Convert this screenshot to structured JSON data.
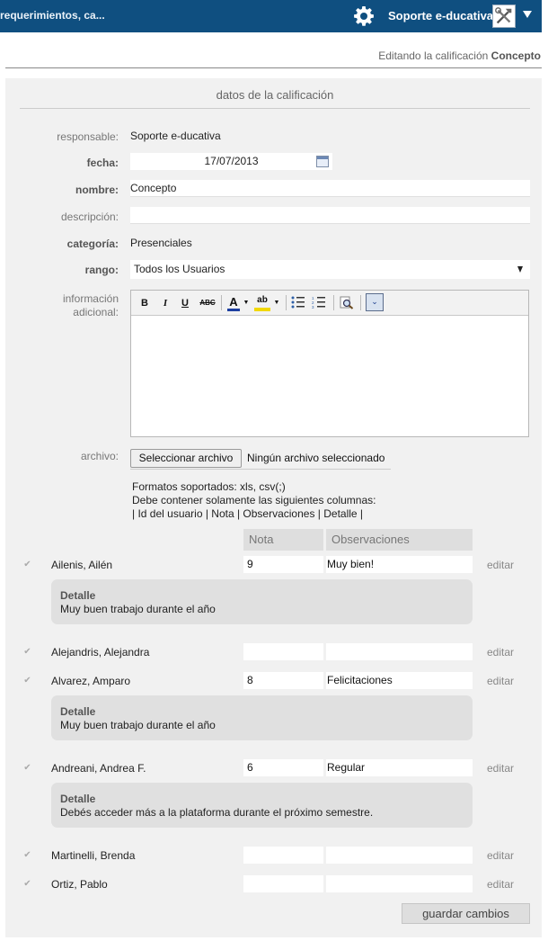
{
  "header": {
    "breadcrumb": "requerimientos, ca...",
    "user_name": "Soporte e-ducativa",
    "icons": {
      "settings": "gear-icon",
      "tools": "tools-icon",
      "menu": "caret-down-icon"
    },
    "colors": {
      "bar": "#0f4f80"
    }
  },
  "editing": {
    "prefix": "Editando la calificación",
    "name": "Concepto"
  },
  "form": {
    "title": "datos de la calificación",
    "responsable": {
      "label": "responsable:",
      "value": "Soporte e-ducativa"
    },
    "fecha": {
      "label": "fecha:",
      "value": "17/07/2013"
    },
    "nombre": {
      "label": "nombre:",
      "value": "Concepto"
    },
    "descripcion": {
      "label": "descripción:",
      "value": ""
    },
    "categoria": {
      "label": "categoría:",
      "value": "Presenciales"
    },
    "rango": {
      "label": "rango:",
      "value": "Todos los Usuarios"
    },
    "info_adicional": {
      "label_1": "información",
      "label_2": "adicional:"
    },
    "toolbar": {
      "bold": "B",
      "italic": "I",
      "underline": "U",
      "strike": "ABC",
      "font_color": "A",
      "highlight": "ab"
    },
    "archivo": {
      "label": "archivo:",
      "button": "Seleccionar archivo",
      "status": "Ningún archivo seleccionado",
      "formats": "Formatos soportados: xls, csv(;)",
      "columns_intro": "Debe contener solamente las siguientes columnas:",
      "columns": "| Id del usuario | Nota | Observaciones | Detalle |"
    }
  },
  "grades": {
    "col_nota": "Nota",
    "col_obs": "Observaciones",
    "edit_label": "editar",
    "detail_title": "Detalle",
    "rows": [
      {
        "name": "Ailenis, Ailén",
        "nota": "9",
        "obs": "Muy bien!",
        "detail": "Muy buen trabajo durante el año"
      },
      {
        "name": "Alejandris, Alejandra",
        "nota": "",
        "obs": ""
      },
      {
        "name": "Alvarez, Amparo",
        "nota": "8",
        "obs": "Felicitaciones",
        "detail": "Muy buen trabajo durante el año"
      },
      {
        "name": "Andreani, Andrea F.",
        "nota": "6",
        "obs": "Regular",
        "detail": "Debés acceder más a la plataforma durante el próximo semestre."
      },
      {
        "name": "Martinelli, Brenda",
        "nota": "",
        "obs": ""
      },
      {
        "name": "Ortiz, Pablo",
        "nota": "",
        "obs": ""
      }
    ]
  },
  "save_button": "guardar cambios"
}
